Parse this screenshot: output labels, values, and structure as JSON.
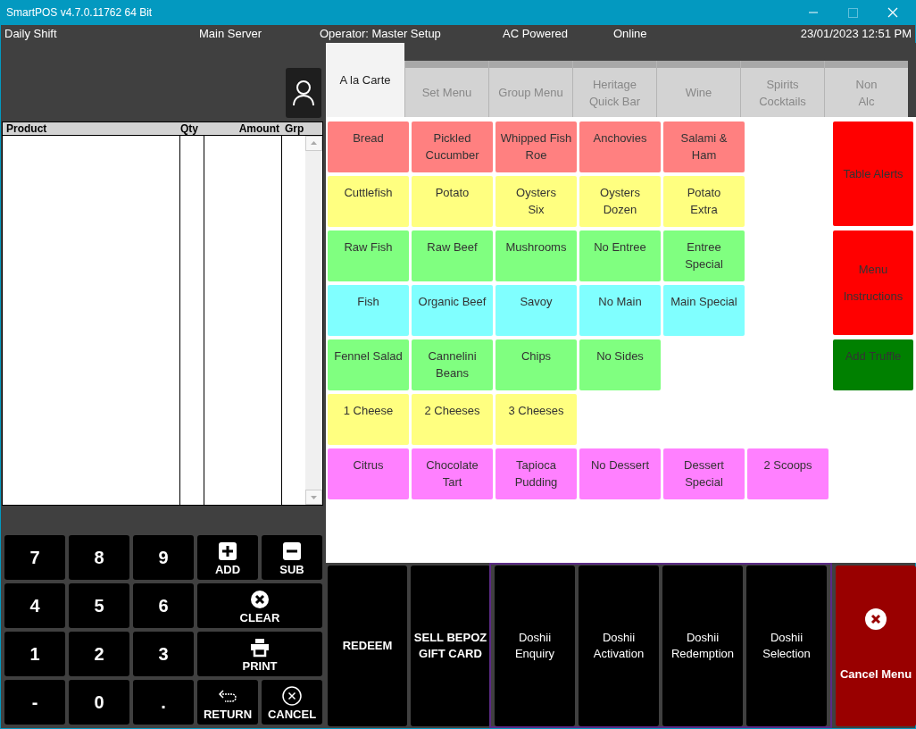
{
  "window": {
    "title": "SmartPOS v4.7.0.11762 64 Bit"
  },
  "status_bar": [
    "Daily Shift",
    "Main Server",
    "Operator: Master Setup",
    "AC Powered",
    "Online",
    "23/01/2023 12:51 PM"
  ],
  "order_table": {
    "columns": [
      "Product",
      "Qty",
      "Amount",
      "Grp"
    ]
  },
  "keypad": [
    {
      "kind": "digit",
      "label": "7"
    },
    {
      "kind": "digit",
      "label": "8"
    },
    {
      "kind": "digit",
      "label": "9"
    },
    {
      "kind": "add",
      "label": "ADD"
    },
    {
      "kind": "sub",
      "label": "SUB"
    },
    {
      "kind": "digit",
      "label": "4"
    },
    {
      "kind": "digit",
      "label": "5"
    },
    {
      "kind": "digit",
      "label": "6"
    },
    {
      "kind": "clear",
      "label": "CLEAR"
    },
    {
      "kind": "digit",
      "label": "1"
    },
    {
      "kind": "digit",
      "label": "2"
    },
    {
      "kind": "digit",
      "label": "3"
    },
    {
      "kind": "print",
      "label": "PRINT"
    },
    {
      "kind": "digit",
      "label": "-"
    },
    {
      "kind": "digit",
      "label": "0"
    },
    {
      "kind": "digit",
      "label": "."
    },
    {
      "kind": "return",
      "label": "RETURN"
    },
    {
      "kind": "cancel",
      "label": "CANCEL"
    }
  ],
  "tabs": [
    {
      "lines": [
        "A la Carte"
      ],
      "selected": true
    },
    {
      "lines": [
        "Set Menu"
      ],
      "selected": false
    },
    {
      "lines": [
        "Group Menu"
      ],
      "selected": false
    },
    {
      "lines": [
        "Heritage",
        "Quick Bar"
      ],
      "selected": false
    },
    {
      "lines": [
        "Wine"
      ],
      "selected": false
    },
    {
      "lines": [
        "Spirits",
        "Cocktails"
      ],
      "selected": false
    },
    {
      "lines": [
        "Non",
        "Alc"
      ],
      "selected": false
    }
  ],
  "menu_rows": [
    [
      {
        "lines": [
          "Bread"
        ],
        "color": "#ff8080"
      },
      {
        "lines": [
          "Pickled",
          "Cucumber"
        ],
        "color": "#ff8080"
      },
      {
        "lines": [
          "Whipped Fish",
          "Roe"
        ],
        "color": "#ff8080"
      },
      {
        "lines": [
          "Anchovies"
        ],
        "color": "#ff8080"
      },
      {
        "lines": [
          "Salami &",
          "Ham"
        ],
        "color": "#ff8080"
      }
    ],
    [
      {
        "lines": [
          "Cuttlefish"
        ],
        "color": "#ffff80"
      },
      {
        "lines": [
          "Potato"
        ],
        "color": "#ffff80"
      },
      {
        "lines": [
          "Oysters",
          "Six"
        ],
        "color": "#ffff80"
      },
      {
        "lines": [
          "Oysters",
          "Dozen"
        ],
        "color": "#ffff80"
      },
      {
        "lines": [
          "Potato",
          "Extra"
        ],
        "color": "#ffff80"
      }
    ],
    [
      {
        "lines": [
          "Raw Fish"
        ],
        "color": "#80ff80"
      },
      {
        "lines": [
          "Raw Beef"
        ],
        "color": "#80ff80"
      },
      {
        "lines": [
          "Mushrooms"
        ],
        "color": "#80ff80"
      },
      {
        "lines": [
          "No Entree"
        ],
        "color": "#80ff80"
      },
      {
        "lines": [
          "Entree",
          "Special"
        ],
        "color": "#80ff80"
      }
    ],
    [
      {
        "lines": [
          "Fish"
        ],
        "color": "#80ffff"
      },
      {
        "lines": [
          "Organic Beef"
        ],
        "color": "#80ffff"
      },
      {
        "lines": [
          "Savoy"
        ],
        "color": "#80ffff"
      },
      {
        "lines": [
          "No Main"
        ],
        "color": "#80ffff"
      },
      {
        "lines": [
          "Main Special"
        ],
        "color": "#80ffff"
      }
    ],
    [
      {
        "lines": [
          "Fennel Salad"
        ],
        "color": "#80ff80"
      },
      {
        "lines": [
          "Cannelini",
          "Beans"
        ],
        "color": "#80ff80"
      },
      {
        "lines": [
          "Chips"
        ],
        "color": "#80ff80"
      },
      {
        "lines": [
          "No Sides"
        ],
        "color": "#80ff80"
      }
    ],
    [
      {
        "lines": [
          "1 Cheese"
        ],
        "color": "#ffff80"
      },
      {
        "lines": [
          "2 Cheeses"
        ],
        "color": "#ffff80"
      },
      {
        "lines": [
          "3 Cheeses"
        ],
        "color": "#ffff80"
      }
    ],
    [
      {
        "lines": [
          "Citrus"
        ],
        "color": "#ff80ff"
      },
      {
        "lines": [
          "Chocolate",
          "Tart"
        ],
        "color": "#ff80ff"
      },
      {
        "lines": [
          "Tapioca",
          "Pudding"
        ],
        "color": "#ff80ff"
      },
      {
        "lines": [
          "No Dessert"
        ],
        "color": "#ff80ff"
      },
      {
        "lines": [
          "Dessert",
          "Special"
        ],
        "color": "#ff80ff"
      },
      {
        "lines": [
          "2 Scoops"
        ],
        "color": "#ff80ff"
      }
    ]
  ],
  "side_buttons": [
    {
      "lines": [
        "Table Alerts"
      ],
      "color": "#ff0000",
      "kind": "tall"
    },
    {
      "lines": [
        "Menu",
        "Instructions"
      ],
      "color": "#ff0000",
      "kind": "tall"
    },
    {
      "lines": [
        "Add Truffle"
      ],
      "color": "#008000",
      "kind": "short"
    }
  ],
  "actions": [
    {
      "lines": [
        "REDEEM"
      ]
    },
    {
      "lines": [
        "SELL BEPOZ",
        "GIFT CARD"
      ]
    }
  ],
  "doshii": [
    {
      "lines": [
        "Doshii",
        "Enquiry"
      ]
    },
    {
      "lines": [
        "Doshii",
        "Activation"
      ]
    },
    {
      "lines": [
        "Doshii",
        "Redemption"
      ]
    },
    {
      "lines": [
        "Doshii",
        "Selection"
      ]
    }
  ],
  "cancel_menu": {
    "label": "Cancel Menu"
  }
}
